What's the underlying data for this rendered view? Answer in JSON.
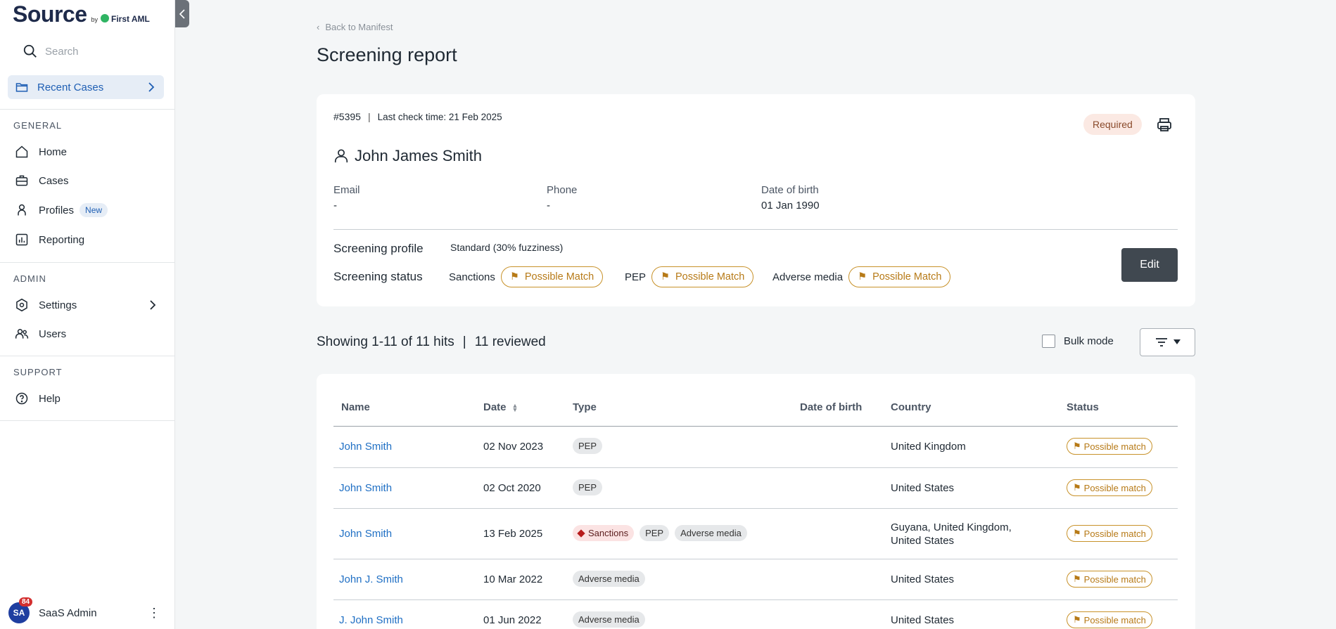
{
  "sidebar": {
    "brand": {
      "name": "Source",
      "by": "by",
      "partner": "First AML"
    },
    "search_placeholder": "Search",
    "recent_cases": "Recent Cases",
    "sections": {
      "general": "GENERAL",
      "admin": "ADMIN",
      "support": "SUPPORT"
    },
    "items": {
      "home": "Home",
      "cases": "Cases",
      "profiles": "Profiles",
      "profiles_badge": "New",
      "reporting": "Reporting",
      "settings": "Settings",
      "users": "Users",
      "help": "Help"
    },
    "user": {
      "initials": "SA",
      "notifications": "84",
      "name": "SaaS Admin"
    }
  },
  "header": {
    "back": "Back to Manifest",
    "title": "Screening report"
  },
  "summary": {
    "case_id": "#5395",
    "last_check": "Last check time: 21 Feb 2025",
    "required": "Required",
    "person_name": "John James Smith",
    "email_label": "Email",
    "email_value": "-",
    "phone_label": "Phone",
    "phone_value": "-",
    "dob_label": "Date of birth",
    "dob_value": "01 Jan 1990",
    "profile_label": "Screening profile",
    "profile_value": "Standard (30% fuzziness)",
    "status_label": "Screening status",
    "statuses": [
      {
        "category": "Sanctions",
        "result": "Possible Match"
      },
      {
        "category": "PEP",
        "result": "Possible Match"
      },
      {
        "category": "Adverse media",
        "result": "Possible Match"
      }
    ],
    "edit": "Edit"
  },
  "hits": {
    "showing": "Showing 1-11 of 11 hits",
    "separator": "|",
    "reviewed": "11 reviewed",
    "bulk_mode": "Bulk mode"
  },
  "table": {
    "columns": {
      "name": "Name",
      "date": "Date",
      "type": "Type",
      "dob": "Date of birth",
      "country": "Country",
      "status": "Status"
    },
    "rows": [
      {
        "name": "John Smith",
        "date": "02 Nov 2023",
        "types": [
          "PEP"
        ],
        "dob": "",
        "country": "United Kingdom",
        "country2": "",
        "status": "Possible match"
      },
      {
        "name": "John Smith",
        "date": "02 Oct 2020",
        "types": [
          "PEP"
        ],
        "dob": "",
        "country": "United States",
        "country2": "",
        "status": "Possible match"
      },
      {
        "name": "John Smith",
        "date": "13 Feb 2025",
        "types": [
          "Sanctions",
          "PEP",
          "Adverse media"
        ],
        "dob": "",
        "country": "Guyana, United Kingdom,",
        "country2": "United States",
        "status": "Possible match"
      },
      {
        "name": "John J. Smith",
        "date": "10 Mar 2022",
        "types": [
          "Adverse media"
        ],
        "dob": "",
        "country": "United States",
        "country2": "",
        "status": "Possible match"
      },
      {
        "name": "J. John Smith",
        "date": "01 Jun 2022",
        "types": [
          "Adverse media"
        ],
        "dob": "",
        "country": "United States",
        "country2": "",
        "status": "Possible match"
      }
    ]
  },
  "colors": {
    "accent": "#1f6fc4",
    "match": "#b77a17",
    "sidebar_active": "#e6edf6",
    "edit_button": "#404850"
  }
}
